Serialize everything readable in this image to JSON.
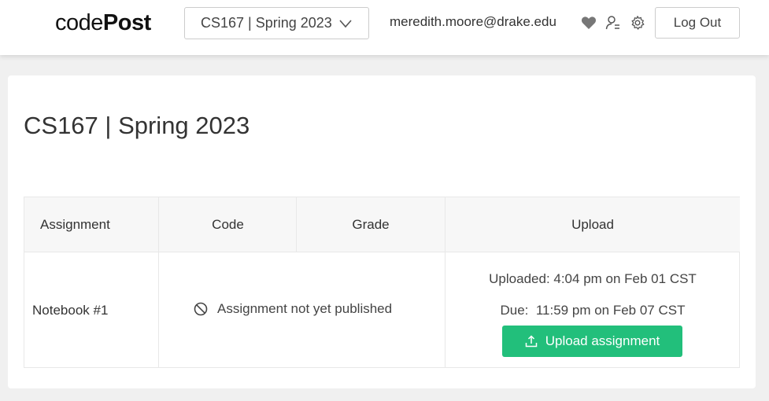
{
  "header": {
    "logo_regular": "code",
    "logo_bold": "Post",
    "course_selector": "CS167 | Spring 2023",
    "user_email": "meredith.moore@drake.edu",
    "logout_label": "Log Out",
    "icons": [
      "heart-icon",
      "user-switch-icon",
      "gear-icon"
    ]
  },
  "page": {
    "title": "CS167 | Spring 2023"
  },
  "table": {
    "columns": [
      "Assignment",
      "Code",
      "Grade",
      "Upload"
    ],
    "rows": [
      {
        "assignment": "Notebook #1",
        "status": "Assignment not yet published",
        "uploaded": "Uploaded: 4:04 pm on Feb 01 CST",
        "due": "Due:  11:59 pm on Feb 07 CST",
        "action": "Upload assignment"
      }
    ]
  },
  "colors": {
    "accent": "#22bf7b",
    "header_bg": "#ffffff",
    "page_bg": "#f0f0f0"
  }
}
